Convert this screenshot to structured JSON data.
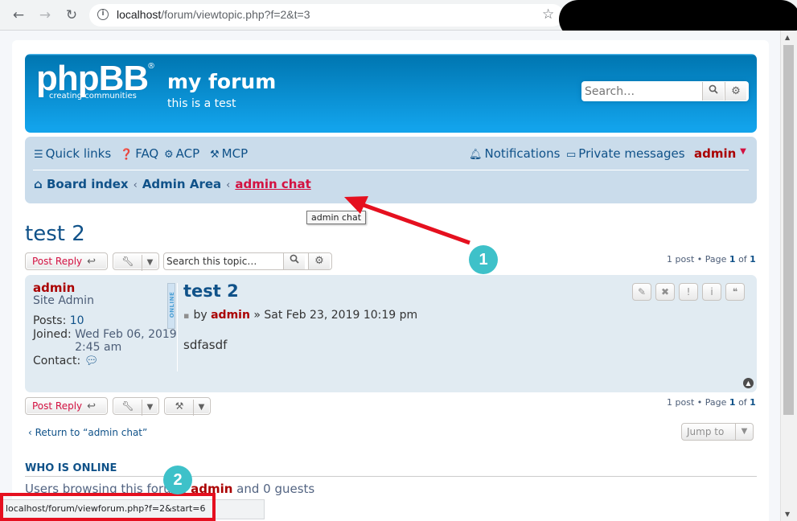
{
  "browser": {
    "url_host": "localhost",
    "url_path": "/forum/viewtopic.php?f=2&t=3",
    "status_url": "localhost/forum/viewforum.php?f=2&start=6"
  },
  "header": {
    "logo_text": "phpBB",
    "logo_reg": "®",
    "logo_tagline": "creating   communities",
    "site_title": "my forum",
    "site_description": "this is a test",
    "search_placeholder": "Search…"
  },
  "navbar": {
    "quick_links": "Quick links",
    "faq": "FAQ",
    "acp": "ACP",
    "mcp": "MCP",
    "notifications": "Notifications",
    "private_messages": "Private messages",
    "username": "admin"
  },
  "breadcrumbs": [
    "Board index",
    "Admin Area",
    "admin chat"
  ],
  "tooltip": "admin chat",
  "topic": {
    "title": "test 2",
    "post_reply": "Post Reply",
    "search_placeholder": "Search this topic…",
    "pagination": {
      "posts": "1 post",
      "sep": "•",
      "page_label": "Page",
      "current": "1",
      "of": "of",
      "total": "1"
    }
  },
  "post": {
    "author": "admin",
    "rank": "Site Admin",
    "posts_label": "Posts:",
    "posts_value": "10",
    "joined_label": "Joined:",
    "joined_value": "Wed Feb 06, 2019 2:45 am",
    "contact_label": "Contact:",
    "online_label": "ONLINE",
    "title": "test 2",
    "by": "by",
    "date": "» Sat Feb 23, 2019 10:19 pm",
    "body": "sdfasdf"
  },
  "footer": {
    "return_link": "Return to “admin chat”",
    "jump_to": "Jump to",
    "who_title": "WHO IS ONLINE",
    "who_prefix": "Users browsing this forum:",
    "who_user": "admin",
    "who_suffix": "and 0 guests"
  },
  "annotations": {
    "badge_1": "1",
    "badge_2": "2"
  },
  "colors": {
    "brand": "#105289",
    "header_blue": "#12a3eb",
    "accent_red": "#d31141",
    "annotation_red": "#e5101f",
    "badge_teal": "#3ec1c9"
  }
}
